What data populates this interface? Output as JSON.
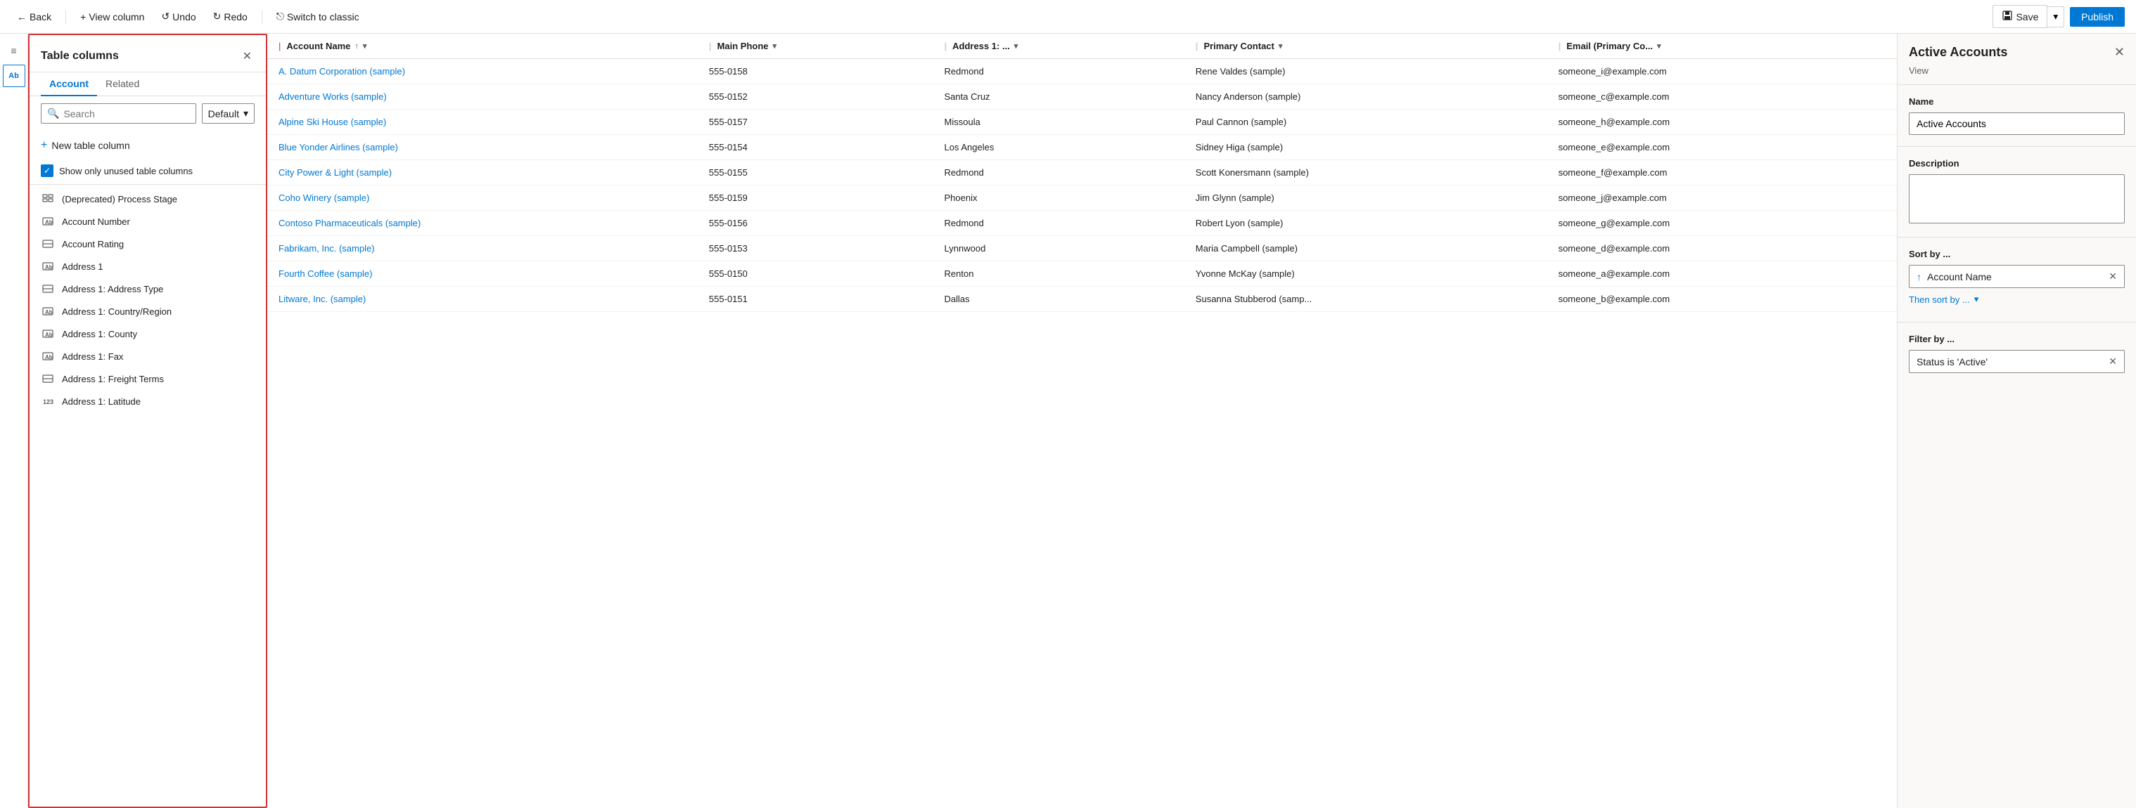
{
  "toolbar": {
    "back_label": "Back",
    "view_column_label": "View column",
    "undo_label": "Undo",
    "redo_label": "Redo",
    "switch_label": "Switch to classic",
    "save_label": "Save",
    "publish_label": "Publish"
  },
  "panel": {
    "title": "Table columns",
    "tab_account": "Account",
    "tab_related": "Related",
    "search_placeholder": "Search",
    "dropdown_label": "Default",
    "new_col_label": "New table column",
    "unused_label": "Show only unused table columns",
    "columns": [
      {
        "name": "(Deprecated) Process Stage",
        "type": "grid"
      },
      {
        "name": "Account Number",
        "type": "text"
      },
      {
        "name": "Account Rating",
        "type": "choice"
      },
      {
        "name": "Address 1",
        "type": "text"
      },
      {
        "name": "Address 1: Address Type",
        "type": "choice"
      },
      {
        "name": "Address 1: Country/Region",
        "type": "text"
      },
      {
        "name": "Address 1: County",
        "type": "text"
      },
      {
        "name": "Address 1: Fax",
        "type": "text"
      },
      {
        "name": "Address 1: Freight Terms",
        "type": "choice"
      },
      {
        "name": "Address 1: Latitude",
        "type": "number"
      }
    ]
  },
  "table": {
    "columns": [
      {
        "label": "Account Name",
        "sort": true,
        "chevron": true
      },
      {
        "label": "Main Phone",
        "sort": false,
        "chevron": true
      },
      {
        "label": "Address 1: ...",
        "sort": false,
        "chevron": true
      },
      {
        "label": "Primary Contact",
        "sort": false,
        "chevron": true
      },
      {
        "label": "Email (Primary Co...",
        "sort": false,
        "chevron": true
      }
    ],
    "rows": [
      {
        "account": "A. Datum Corporation (sample)",
        "phone": "555-0158",
        "address": "Redmond",
        "contact": "Rene Valdes (sample)",
        "email": "someone_i@example.com"
      },
      {
        "account": "Adventure Works (sample)",
        "phone": "555-0152",
        "address": "Santa Cruz",
        "contact": "Nancy Anderson (sample)",
        "email": "someone_c@example.com"
      },
      {
        "account": "Alpine Ski House (sample)",
        "phone": "555-0157",
        "address": "Missoula",
        "contact": "Paul Cannon (sample)",
        "email": "someone_h@example.com"
      },
      {
        "account": "Blue Yonder Airlines (sample)",
        "phone": "555-0154",
        "address": "Los Angeles",
        "contact": "Sidney Higa (sample)",
        "email": "someone_e@example.com"
      },
      {
        "account": "City Power & Light (sample)",
        "phone": "555-0155",
        "address": "Redmond",
        "contact": "Scott Konersmann (sample)",
        "email": "someone_f@example.com"
      },
      {
        "account": "Coho Winery (sample)",
        "phone": "555-0159",
        "address": "Phoenix",
        "contact": "Jim Glynn (sample)",
        "email": "someone_j@example.com"
      },
      {
        "account": "Contoso Pharmaceuticals (sample)",
        "phone": "555-0156",
        "address": "Redmond",
        "contact": "Robert Lyon (sample)",
        "email": "someone_g@example.com"
      },
      {
        "account": "Fabrikam, Inc. (sample)",
        "phone": "555-0153",
        "address": "Lynnwood",
        "contact": "Maria Campbell (sample)",
        "email": "someone_d@example.com"
      },
      {
        "account": "Fourth Coffee (sample)",
        "phone": "555-0150",
        "address": "Renton",
        "contact": "Yvonne McKay (sample)",
        "email": "someone_a@example.com"
      },
      {
        "account": "Litware, Inc. (sample)",
        "phone": "555-0151",
        "address": "Dallas",
        "contact": "Susanna Stubberod (samp...",
        "email": "someone_b@example.com"
      }
    ]
  },
  "right_panel": {
    "title": "Active Accounts",
    "subtitle": "View",
    "close_label": "✕",
    "name_label": "Name",
    "name_value": "Active Accounts",
    "description_label": "Description",
    "description_value": "",
    "sort_label": "Sort by ...",
    "sort_field": "Account Name",
    "then_sort_label": "Then sort by ...",
    "filter_label": "Filter by ...",
    "filter_value": "Status is 'Active'"
  },
  "icons": {
    "back": "←",
    "plus": "+",
    "undo": "↺",
    "redo": "↻",
    "switch": "⎋",
    "save": "💾",
    "chevron_down": "▾",
    "chevron_up": "▴",
    "sort_asc": "↑",
    "close": "✕",
    "search": "🔍",
    "check": "✓",
    "hamburger": "≡",
    "textfield": "Ab",
    "grid_icon": "⊞",
    "choice_icon": "⊟",
    "number_icon": "##"
  }
}
